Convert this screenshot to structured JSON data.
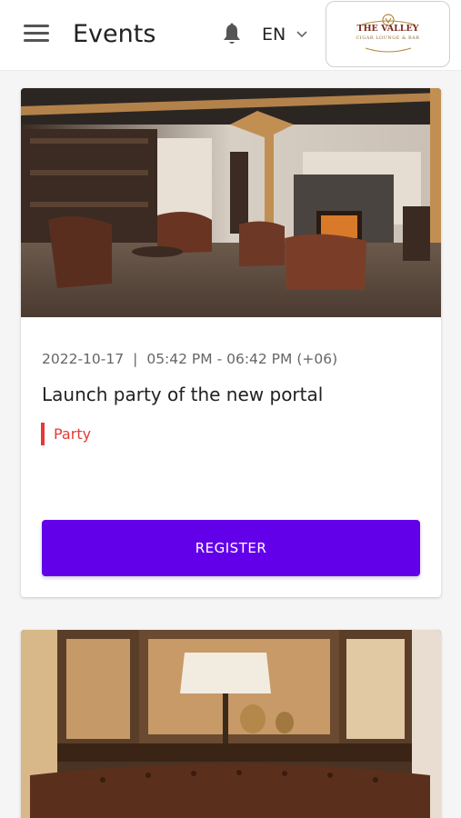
{
  "header": {
    "title": "Events",
    "language": "EN",
    "logo_text_line1": "THE VALLEY",
    "logo_text_line2": "CIGAR LOUNGE & BAR"
  },
  "events": [
    {
      "date": "2022-10-17",
      "time": "05:42 PM - 06:42 PM (+06)",
      "title": "Launch party of the new portal",
      "tag": "Party",
      "register_label": "REGISTER"
    }
  ],
  "colors": {
    "accent": "#6200ea",
    "tag": "#e53935"
  },
  "icons": [
    "menu-icon",
    "bell-icon",
    "chevron-down-icon",
    "logo"
  ]
}
